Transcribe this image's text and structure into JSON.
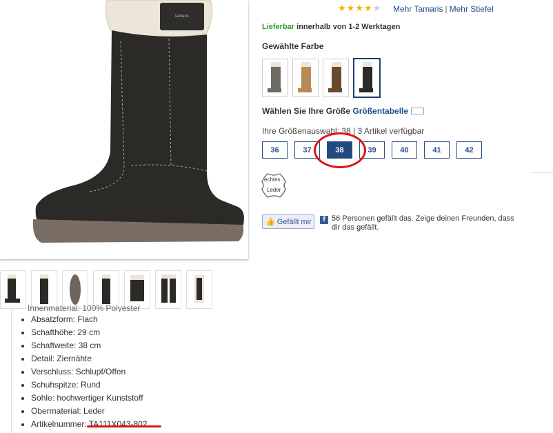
{
  "rating": {
    "stars_filled": 4,
    "stars_total": 5
  },
  "brand_links": {
    "brand": "Mehr Tamaris",
    "separator": "|",
    "category": "Mehr Stiefel"
  },
  "availability": {
    "status": "Lieferbar",
    "text": "innerhalb von 1-2 Werktagen",
    "status_color": "#2a9a2a"
  },
  "color_section": {
    "title": "Gewählte Farbe",
    "swatches": [
      {
        "name": "grey-boot-swatch",
        "color": "#6e6a66",
        "selected": false
      },
      {
        "name": "tan-boot-swatch",
        "color": "#b98a55",
        "selected": false
      },
      {
        "name": "brown-boot-swatch",
        "color": "#6b4a2b",
        "selected": false
      },
      {
        "name": "black-boot-swatch",
        "color": "#2b2a28",
        "selected": true
      }
    ]
  },
  "size_section": {
    "title": "Wählen Sie Ihre Größe",
    "size_chart_link": "Größentabelle",
    "selection_info": "Ihre Größenauswahl: 38 | 3 Artikel verfügbar",
    "sizes": [
      "36",
      "37",
      "38",
      "39",
      "40",
      "41",
      "42"
    ],
    "selected": "38"
  },
  "leather_badge": {
    "line1": "echtes",
    "line2": "Leder"
  },
  "facebook": {
    "like_label": "Gefällt mir",
    "icon_letter": "f",
    "text": "56 Personen gefällt das. Zeige deinen Freunden, dass dir das gefällt."
  },
  "details": {
    "cut_off_line": "Innenmaterial: 100% Polyester",
    "items": [
      "Absatzform: Flach",
      "Schafthöhe: 29 cm",
      "Schaftweite: 38 cm",
      "Detail: Ziernähte",
      "Verschluss: Schlupf/Offen",
      "Schuhspitze: Rund",
      "Sohle: hochwertiger Kunststoff",
      "Obermaterial: Leder",
      "Artikelnummer: TA111X043-802"
    ]
  },
  "colors": {
    "accent": "#1d4d8a",
    "selected_size": "#23497e",
    "highlight": "#e0141b",
    "star": "#f2b200"
  }
}
